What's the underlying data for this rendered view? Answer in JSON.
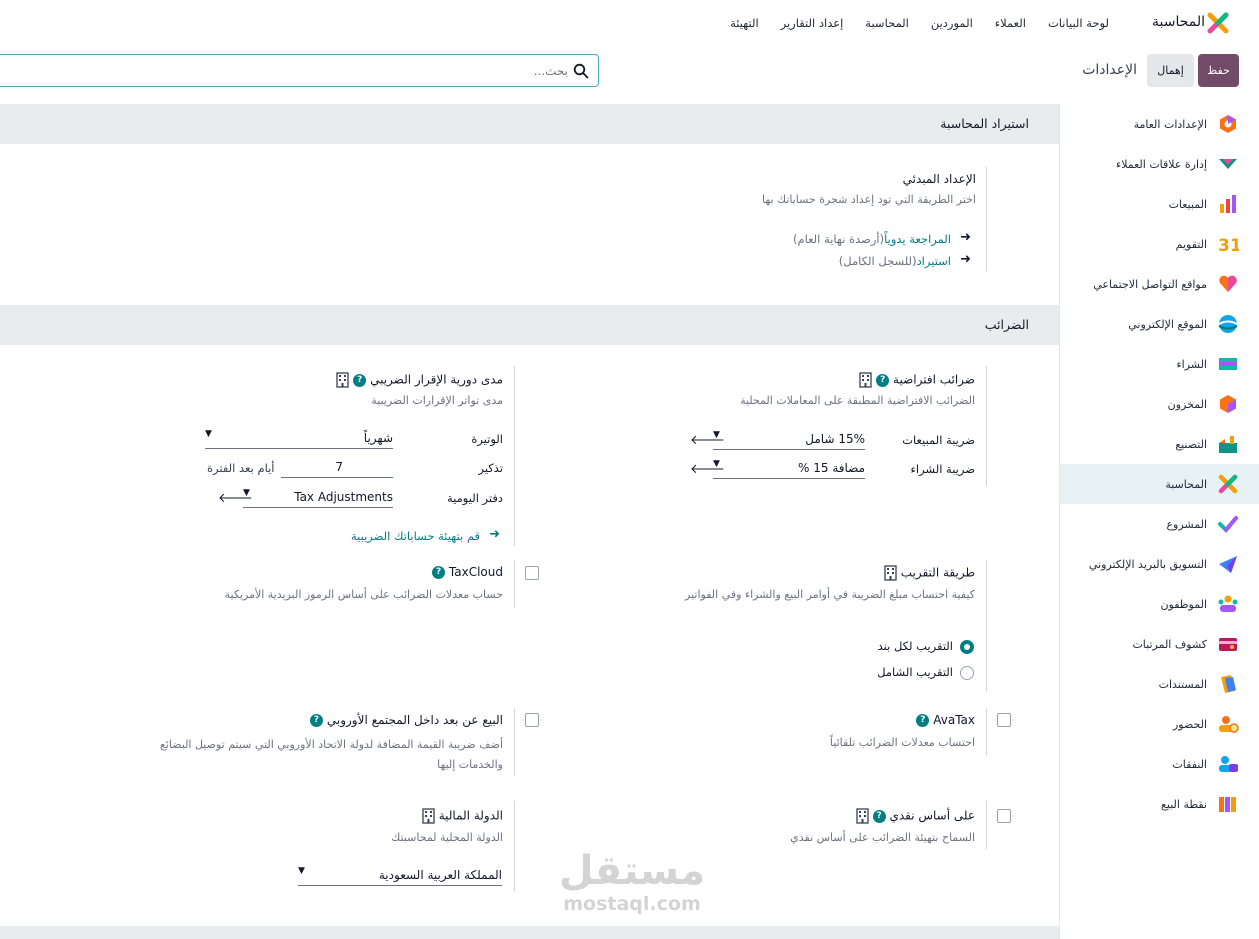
{
  "topbar": {
    "app_name": "المحاسبة",
    "menu": [
      "لوحة البيانات",
      "العملاء",
      "الموردين",
      "المحاسبة",
      "إعداد التقارير",
      "التهيئة"
    ]
  },
  "controls": {
    "save_label": "حفظ",
    "discard_label": "إهمال",
    "breadcrumb": "الإعدادات",
    "search_placeholder": "بحث..."
  },
  "sidebar": {
    "items": [
      {
        "label": "الإعدادات العامة",
        "icon": "general-settings-icon"
      },
      {
        "label": "إدارة علاقات العملاء",
        "icon": "crm-icon"
      },
      {
        "label": "المبيعات",
        "icon": "sales-icon"
      },
      {
        "label": "التقويم",
        "icon": "calendar-icon"
      },
      {
        "label": "مواقع التواصل الاجتماعي",
        "icon": "social-icon"
      },
      {
        "label": "الموقع الإلكتروني",
        "icon": "website-icon"
      },
      {
        "label": "الشراء",
        "icon": "purchase-icon"
      },
      {
        "label": "المخزون",
        "icon": "inventory-icon"
      },
      {
        "label": "التصنيع",
        "icon": "manufacturing-icon"
      },
      {
        "label": "المحاسبة",
        "icon": "accounting-icon"
      },
      {
        "label": "المشروع",
        "icon": "project-icon"
      },
      {
        "label": "التسويق بالبريد الإلكتروني",
        "icon": "email-marketing-icon"
      },
      {
        "label": "الموظفون",
        "icon": "employees-icon"
      },
      {
        "label": "كشوف المرتبات",
        "icon": "payroll-icon"
      },
      {
        "label": "المستندات",
        "icon": "documents-icon"
      },
      {
        "label": "الحضور",
        "icon": "attendance-icon"
      },
      {
        "label": "النفقات",
        "icon": "expenses-icon"
      },
      {
        "label": "نقطة البيع",
        "icon": "pos-icon"
      }
    ],
    "active_index": 9
  },
  "import_section": {
    "heading": "استيراد المحاسبة",
    "setting_title": "الإعداد المبدئي",
    "setting_desc": "اختر الطريقة التي تود إعداد شجرة حساباتك بها",
    "link1": "المراجعة يدوياً",
    "link1_note": "(أرصدة نهاية العام)",
    "link2": "استيراد",
    "link2_note": "(للسجل الكامل)"
  },
  "taxes_section": {
    "heading": "الضرائب",
    "default_taxes": {
      "title": "ضرائب افتراضية",
      "desc": "الضرائب الافتراضية المطبقة على المعاملات المحلية",
      "sales_label": "ضريبة المبيعات",
      "sales_value": "15% شامل",
      "purchase_label": "ضريبة الشراء",
      "purchase_value": "مضافة 15 %"
    },
    "periodicity": {
      "title": "مدى دورية الإقرار الضريبي",
      "desc": "مدى تواتر الإقرارات الضريبية",
      "freq_label": "الوتيرة",
      "freq_value": "شهرياً",
      "reminder_label": "تذكير",
      "reminder_value": "7",
      "reminder_suffix": "أيام بعد الفترة",
      "journal_label": "دفتر اليومية",
      "journal_value": "Tax Adjustments",
      "configure_link": "قم بتهيئة حساباتك الضريبية"
    },
    "rounding": {
      "title": "طريقة التقريب",
      "desc": "كيفية احتساب مبلغ الضريبة في أوامر البيع والشراء وفي الفواتير",
      "option1": "التقريب لكل بند",
      "option2": "التقريب الشامل",
      "selected": 1
    },
    "taxcloud": {
      "title": "TaxCloud",
      "desc": "حساب معدلات الضرائب على أساس الرموز البريدية الأمريكية",
      "checked": false
    },
    "avatax": {
      "title": "AvaTax",
      "desc": "احتساب معدلات الضرائب تلقائياً",
      "checked": false
    },
    "eu_sales": {
      "title": "البيع عن بعد داخل المجتمع الأوروبي",
      "desc": "أضف ضريبة القيمة المضافة لدولة الاتحاد الأوروبي التي سيتم توصيل البضائع والخدمات إليها",
      "checked": false
    },
    "cash_basis": {
      "title": "على أساس نقدي",
      "desc": "السماح بتهيئة الضرائب على أساس نقدي",
      "checked": false
    },
    "fiscal_country": {
      "title": "الدولة المالية",
      "desc": "الدولة المحلية لمحاسبتك",
      "value": "المملكة العربية السعودية"
    }
  },
  "watermark": {
    "arabic": "مستقل",
    "latin": "mostaql.com"
  }
}
